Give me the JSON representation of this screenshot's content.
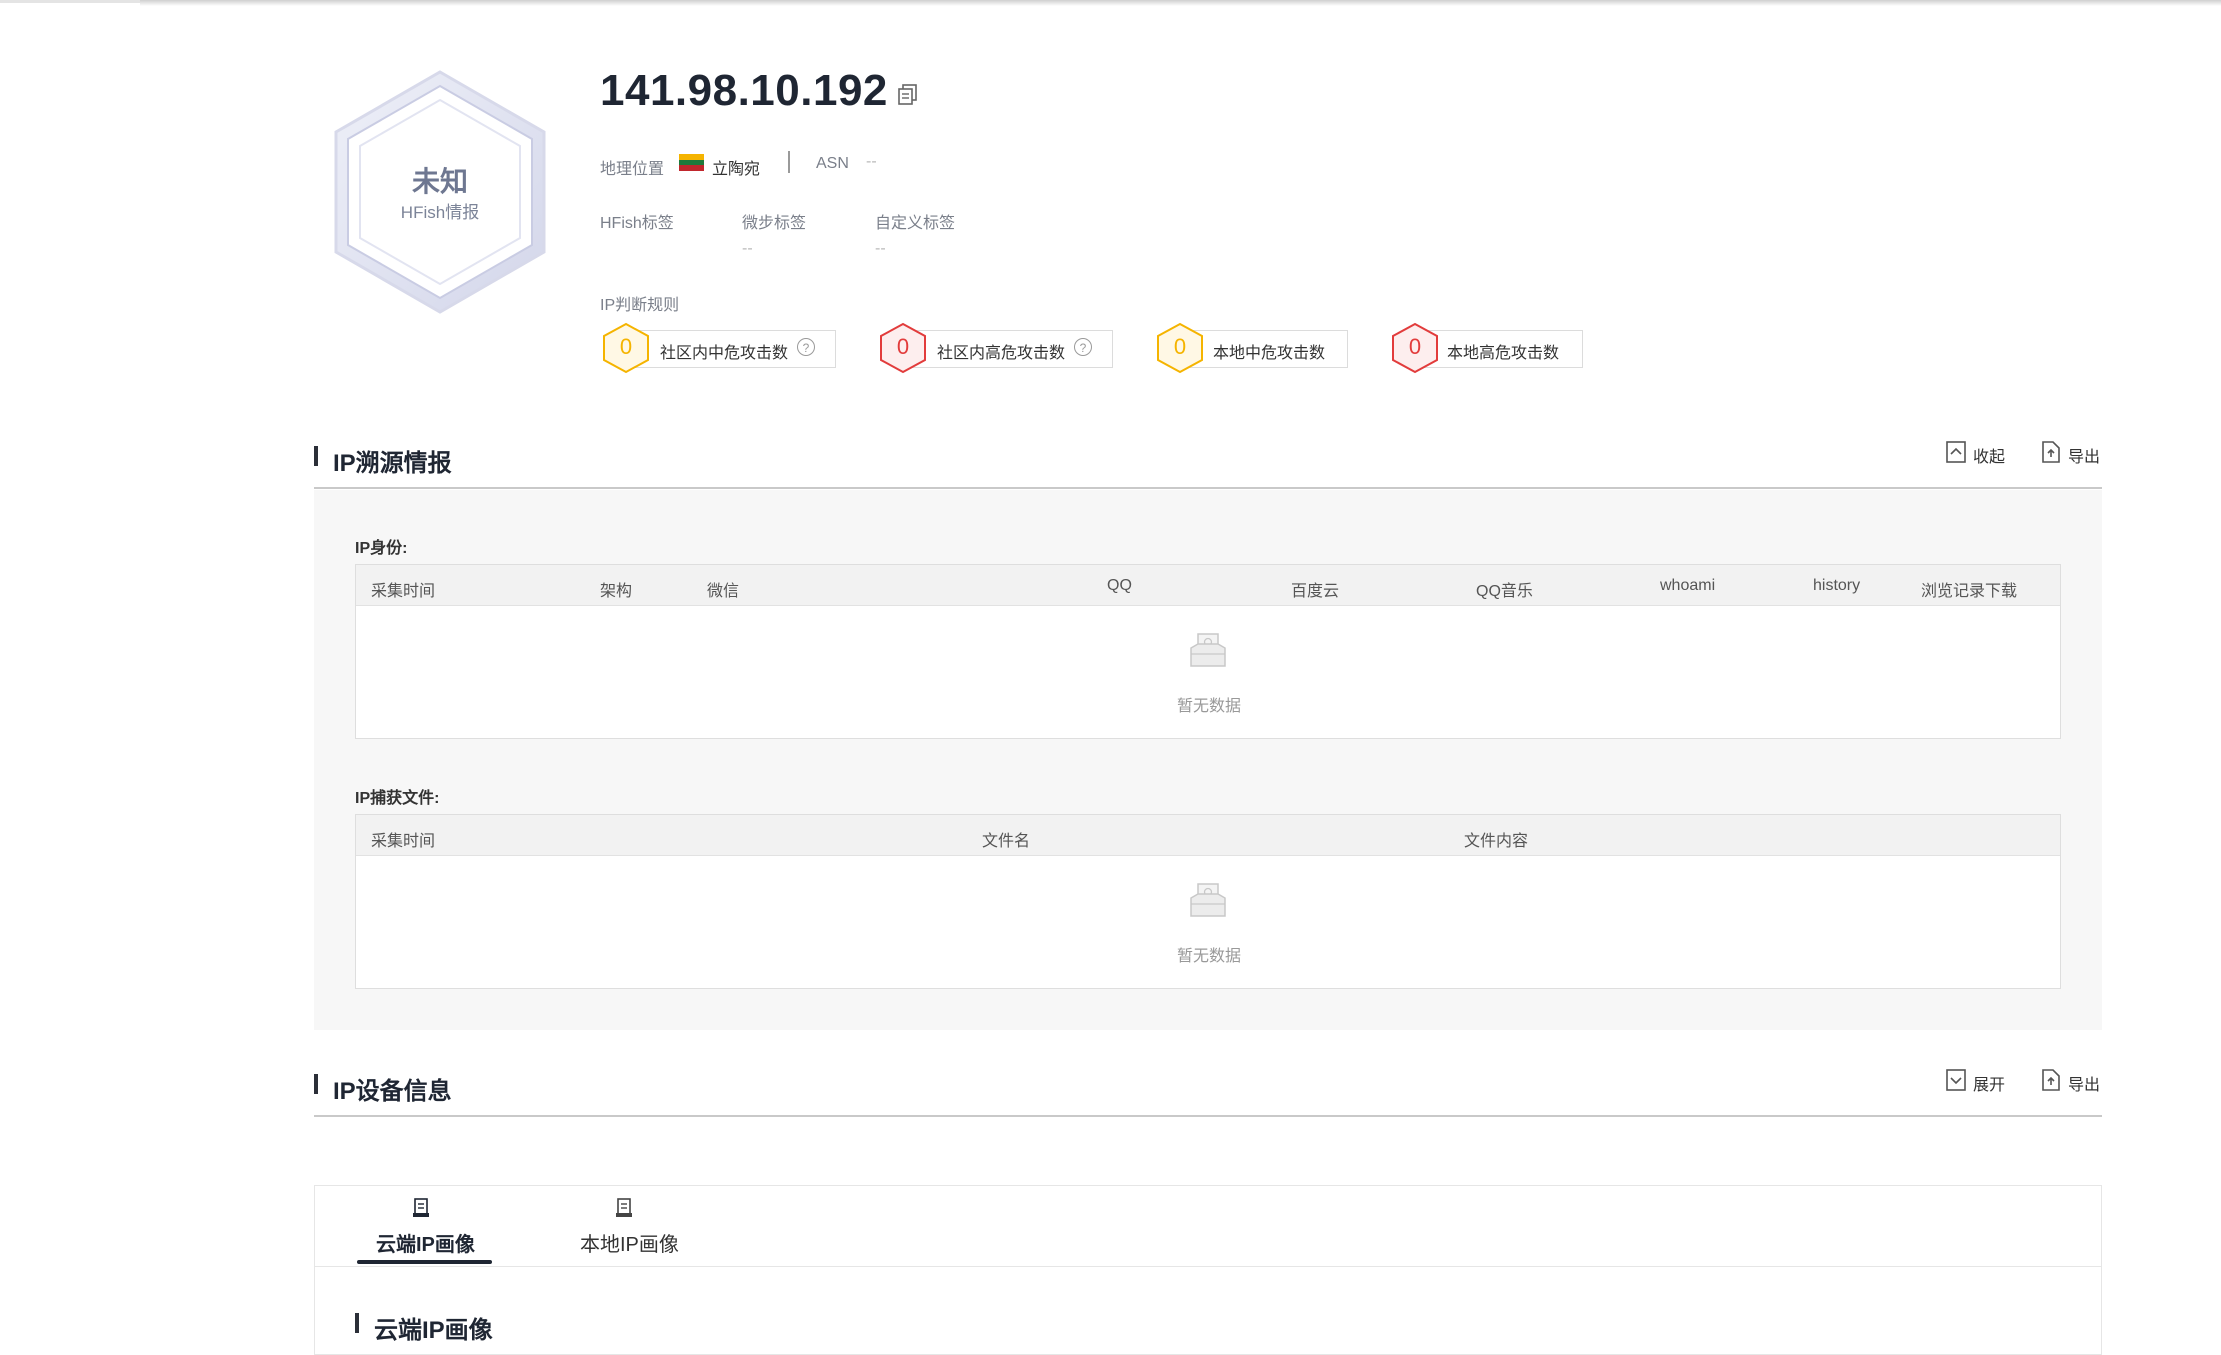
{
  "badge": {
    "title": "未知",
    "subtitle": "HFish情报"
  },
  "header": {
    "ip": "141.98.10.192",
    "geo_label": "地理位置",
    "geo_value": "立陶宛",
    "asn_label": "ASN",
    "asn_value": "--",
    "tags": [
      {
        "label": "HFish标签",
        "value": ""
      },
      {
        "label": "微步标签",
        "value": "--"
      },
      {
        "label": "自定义标签",
        "value": "--"
      }
    ],
    "rules_label": "IP判断规则"
  },
  "rules": [
    {
      "count": "0",
      "label": "社区内中危攻击数",
      "level": "medium",
      "has_help": true
    },
    {
      "count": "0",
      "label": "社区内高危攻击数",
      "level": "high",
      "has_help": true
    },
    {
      "count": "0",
      "label": "本地中危攻击数",
      "level": "medium",
      "has_help": false
    },
    {
      "count": "0",
      "label": "本地高危攻击数",
      "level": "high",
      "has_help": false
    }
  ],
  "colors": {
    "medium": "#f5b400",
    "high": "#e23c3c",
    "dark": "#1f2633"
  },
  "section_intel": {
    "title": "IP溯源情报",
    "collapse_label": "收起",
    "export_label": "导出",
    "identity": {
      "label": "IP身份:",
      "columns": [
        "采集时间",
        "架构",
        "微信",
        "QQ",
        "百度云",
        "QQ音乐",
        "whoami",
        "history",
        "浏览记录下载"
      ],
      "empty_text": "暂无数据"
    },
    "files": {
      "label": "IP捕获文件:",
      "columns": [
        "采集时间",
        "文件名",
        "文件内容"
      ],
      "empty_text": "暂无数据"
    }
  },
  "section_device": {
    "title": "IP设备信息",
    "expand_label": "展开",
    "export_label": "导出"
  },
  "tabs": [
    {
      "label": "云端IP画像",
      "active": true
    },
    {
      "label": "本地IP画像",
      "active": false
    }
  ],
  "cloud_section_title": "云端IP画像"
}
